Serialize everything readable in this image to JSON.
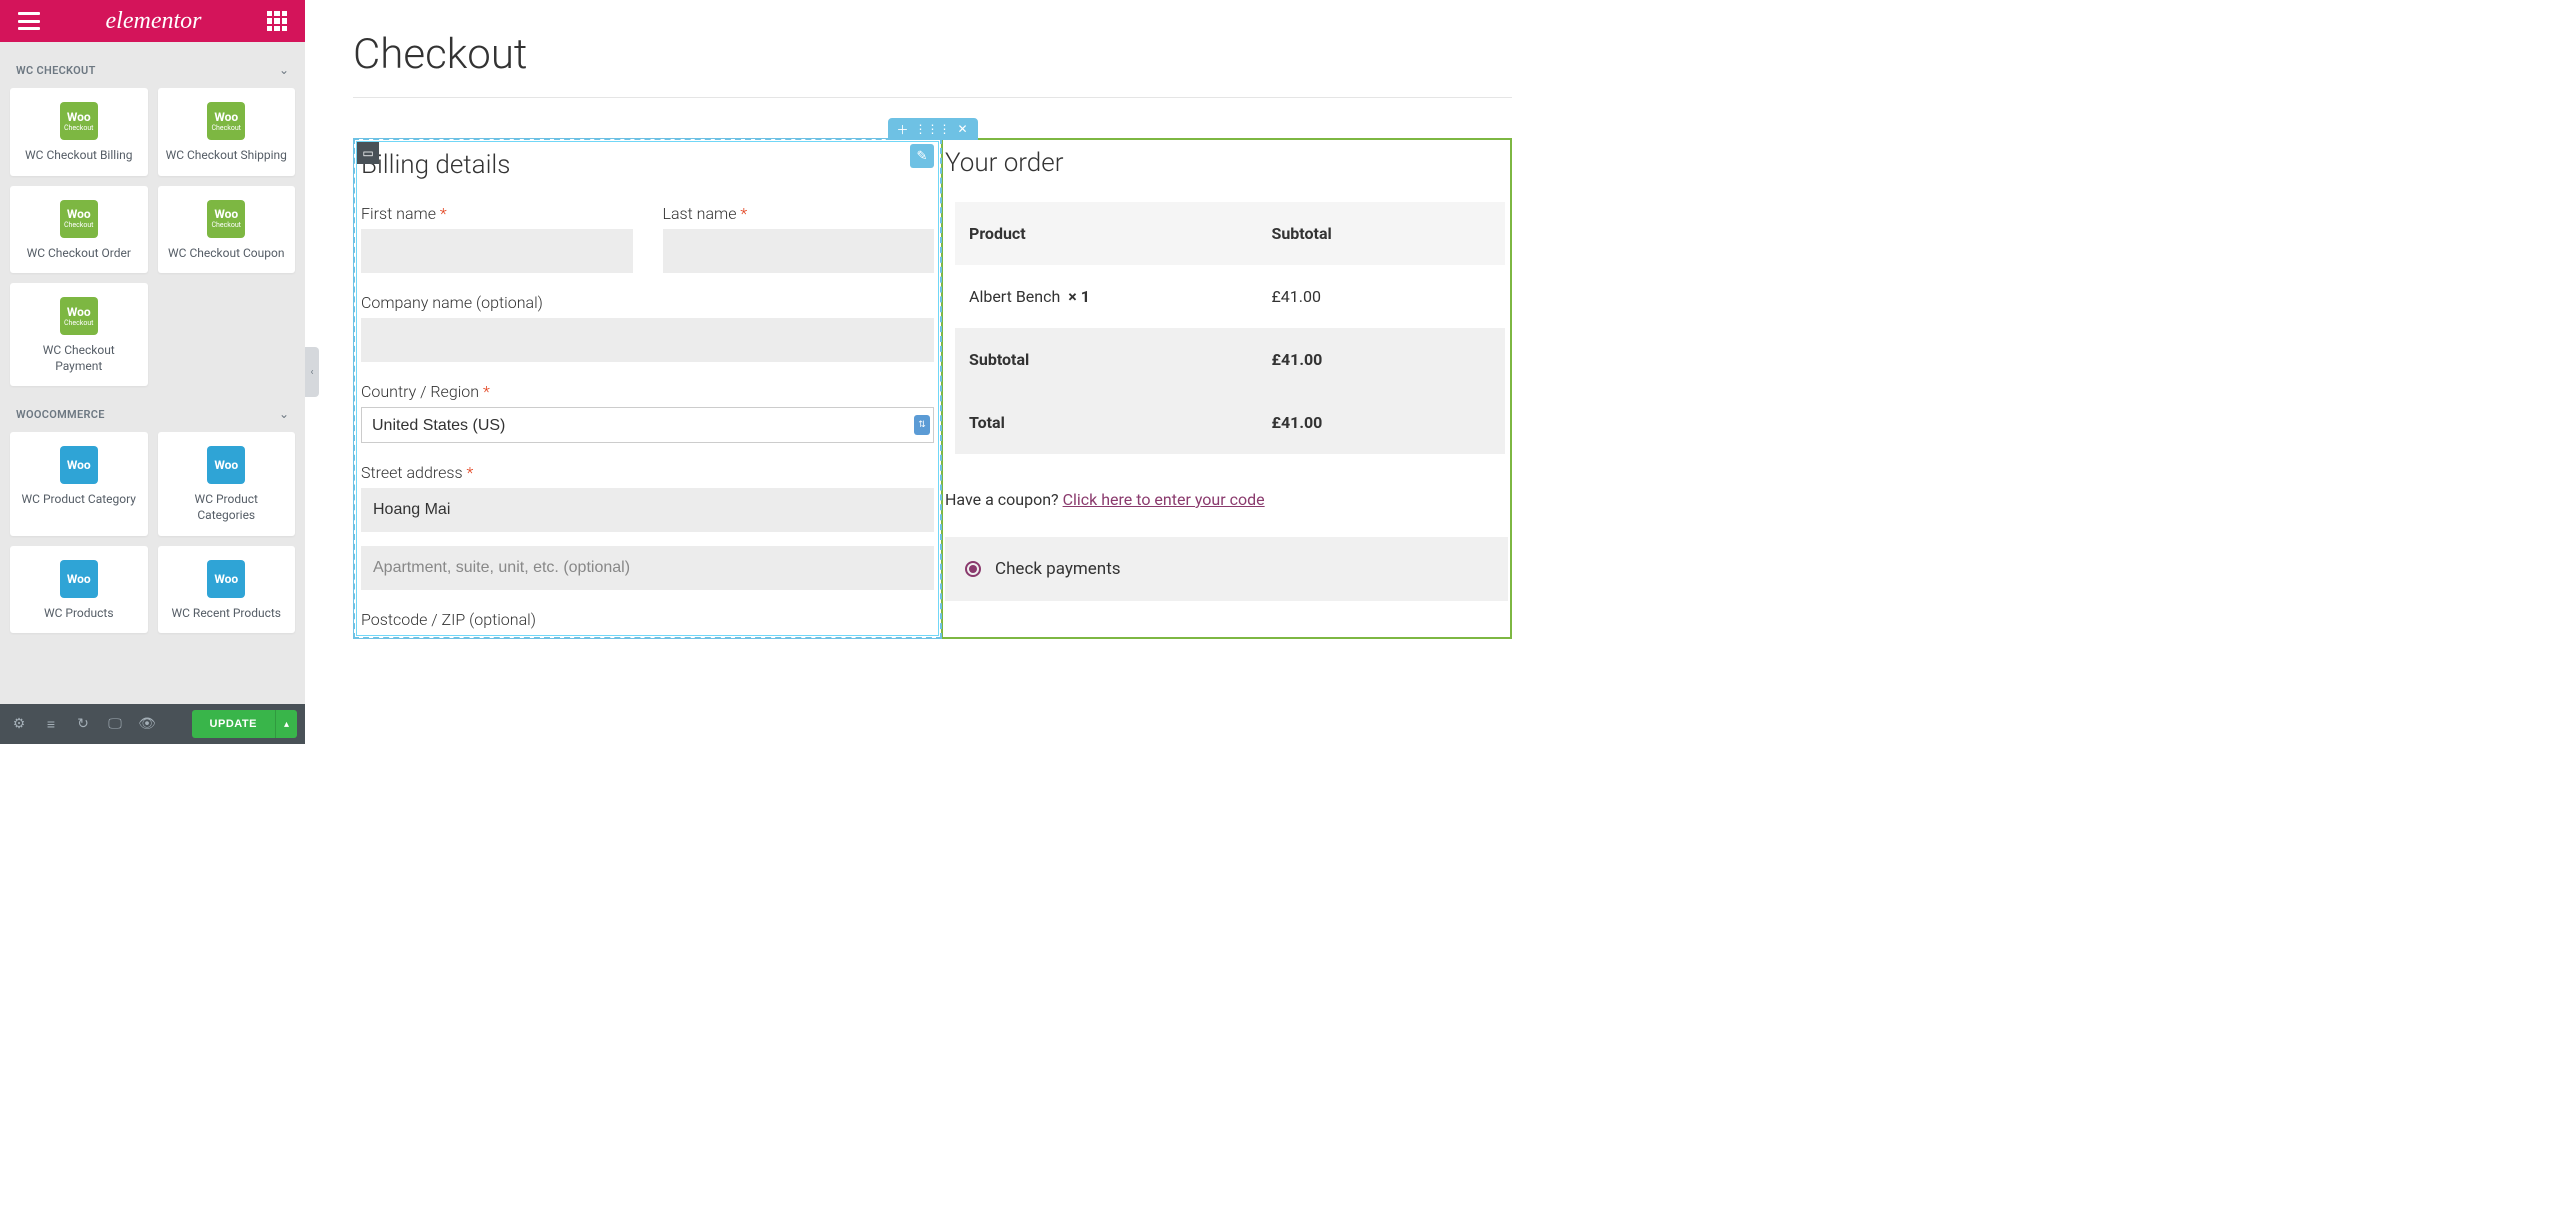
{
  "logo": "elementor",
  "sidebar": {
    "categories": [
      {
        "title": "WC CHECKOUT",
        "widgets": [
          "WC Checkout Billing",
          "WC Checkout Shipping",
          "WC Checkout Order",
          "WC Checkout Coupon",
          "WC Checkout Payment"
        ]
      },
      {
        "title": "WOOCOMMERCE",
        "widgets": [
          "WC Product Category",
          "WC Product Categories",
          "WC Products",
          "WC Recent Products"
        ]
      }
    ]
  },
  "footer": {
    "update": "UPDATE"
  },
  "page": {
    "title": "Checkout",
    "billing_heading": "Billing details",
    "order_heading": "Your order"
  },
  "fields": {
    "first_name": "First name",
    "last_name": "Last name",
    "company": "Company name (optional)",
    "country": "Country / Region",
    "country_value": "United States (US)",
    "street": "Street address",
    "street_value": "Hoang Mai",
    "street2_placeholder": "Apartment, suite, unit, etc. (optional)",
    "postcode": "Postcode / ZIP (optional)",
    "required": "*"
  },
  "order": {
    "head_product": "Product",
    "head_subtotal": "Subtotal",
    "item_name": "Albert Bench",
    "item_qty": "× 1",
    "item_price": "£41.00",
    "subtotal_label": "Subtotal",
    "subtotal_value": "£41.00",
    "total_label": "Total",
    "total_value": "£41.00"
  },
  "coupon": {
    "question": "Have a coupon? ",
    "link": "Click here to enter your code"
  },
  "payment": {
    "check": "Check payments"
  },
  "icons": {
    "woo": "Woo",
    "checkout_sub": "Checkout"
  }
}
